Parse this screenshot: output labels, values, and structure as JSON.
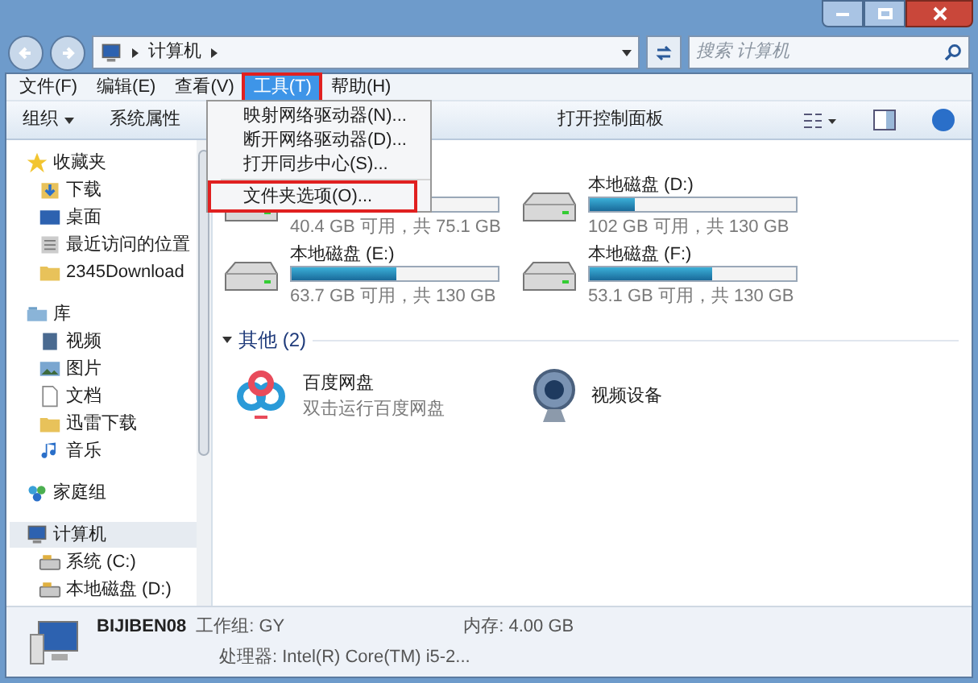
{
  "address": {
    "path": "计算机"
  },
  "search": {
    "placeholder": "搜索 计算机"
  },
  "menu_bar": [
    {
      "label": "文件(F)",
      "selected": false
    },
    {
      "label": "编辑(E)",
      "selected": false
    },
    {
      "label": "查看(V)",
      "selected": false
    },
    {
      "label": "工具(T)",
      "selected": true
    },
    {
      "label": "帮助(H)",
      "selected": false
    }
  ],
  "tools_menu": [
    {
      "label": "映射网络驱动器(N)...",
      "highlighted": false,
      "separator_before": false
    },
    {
      "label": "断开网络驱动器(D)...",
      "highlighted": false,
      "separator_before": false
    },
    {
      "label": "打开同步中心(S)...",
      "highlighted": false,
      "separator_before": false
    },
    {
      "label": "文件夹选项(O)...",
      "highlighted": true,
      "separator_before": true
    }
  ],
  "toolbar": {
    "left": [
      "组织",
      "系统属性"
    ],
    "right_text": "打开控制面板"
  },
  "sidebar": [
    {
      "label": "收藏夹",
      "kind": "star",
      "selected": false,
      "children": [
        {
          "label": "下载",
          "kind": "download"
        },
        {
          "label": "桌面",
          "kind": "desktop"
        },
        {
          "label": "最近访问的位置",
          "kind": "recent"
        },
        {
          "label": "2345Download",
          "kind": "folder"
        }
      ]
    },
    {
      "label": "库",
      "kind": "library",
      "selected": false,
      "children": [
        {
          "label": "视频",
          "kind": "video"
        },
        {
          "label": "图片",
          "kind": "picture"
        },
        {
          "label": "文档",
          "kind": "document"
        },
        {
          "label": "迅雷下载",
          "kind": "folder"
        },
        {
          "label": "音乐",
          "kind": "music"
        }
      ]
    },
    {
      "label": "家庭组",
      "kind": "homegroup",
      "selected": false
    },
    {
      "label": "计算机",
      "kind": "computer",
      "selected": true,
      "children": [
        {
          "label": "系统 (C:)",
          "kind": "drive"
        },
        {
          "label": "本地磁盘 (D:)",
          "kind": "drive"
        }
      ]
    }
  ],
  "drive_rows": [
    {
      "drives": [
        {
          "free": "40.4 GB 可用，共 75.1 GB",
          "level": 0.46
        },
        {
          "name": "本地磁盘 (D:)",
          "free": "102 GB 可用，共 130 GB",
          "level": 0.22
        }
      ]
    },
    {
      "drives": [
        {
          "name": "本地磁盘 (E:)",
          "free": "63.7 GB 可用，共 130 GB",
          "level": 0.51
        },
        {
          "name": "本地磁盘 (F:)",
          "free": "53.1 GB 可用，共 130 GB",
          "level": 0.59
        }
      ]
    }
  ],
  "other_section": {
    "title": "其他 (2)",
    "expanded": true,
    "items": [
      {
        "name": "百度网盘",
        "subtitle": "双击运行百度网盘",
        "kind": "cloud"
      },
      {
        "name": "视频设备",
        "kind": "webcam"
      }
    ]
  },
  "details": {
    "name": "BIJIBEN08",
    "workgroup": "工作组: GY",
    "memory": "内存: 4.00 GB",
    "processor": "处理器: Intel(R) Core(TM) i5-2..."
  }
}
